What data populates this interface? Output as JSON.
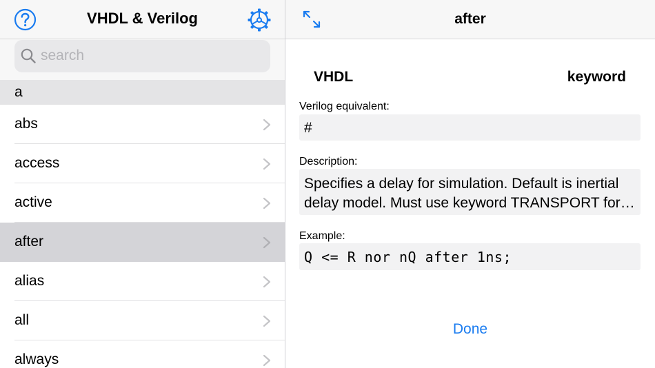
{
  "colors": {
    "accent": "#1a7cf0",
    "selected_row": "#d4d4d8",
    "section_header": "#e4e4e6"
  },
  "master": {
    "title": "VHDL & Verilog",
    "help_icon": "question-circle-icon",
    "settings_icon": "gear-icon",
    "search": {
      "placeholder": "search",
      "value": "",
      "icon": "magnifier-icon"
    },
    "section": "a",
    "items": [
      {
        "label": "abs"
      },
      {
        "label": "access"
      },
      {
        "label": "active"
      },
      {
        "label": "after"
      },
      {
        "label": "alias"
      },
      {
        "label": "all"
      },
      {
        "label": "always"
      }
    ],
    "selected": "after"
  },
  "detail": {
    "title": "after",
    "expand_icon": "expand-arrows-icon",
    "language": "VHDL",
    "kind": "keyword",
    "verilog_label": "Verilog equivalent:",
    "verilog_value": "#",
    "description_label": "Description:",
    "description_value": "Specifies a delay for simulation. Default is inertial delay model.  Must use keyword TRANSPORT for transport delay.",
    "example_label": "Example:",
    "example_value": "Q <= R nor nQ after 1ns;",
    "done_label": "Done"
  }
}
